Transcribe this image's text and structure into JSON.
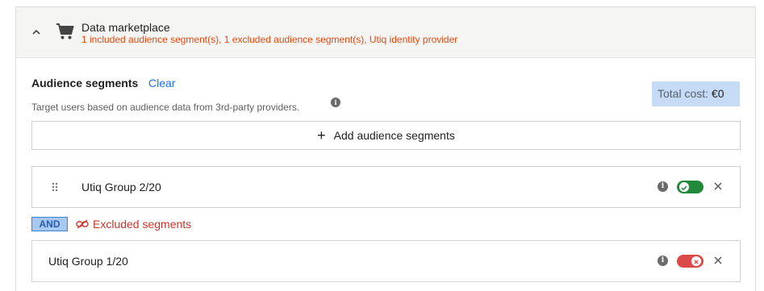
{
  "header": {
    "title": "Data marketplace",
    "summary": "1 included audience segment(s), 1 excluded audience segment(s), Utiq identity provider",
    "chevron_icon": "chevron-up-icon",
    "cart_icon": "shopping-cart-icon"
  },
  "audience": {
    "title": "Audience segments",
    "clear_label": "Clear",
    "description": "Target users based on audience data from 3rd-party providers.",
    "info_icon": "info-icon",
    "total_cost_label": "Total cost:",
    "total_cost_value": "€0",
    "add_button_label": "Add audience segments"
  },
  "segments": [
    {
      "name": "Utiq Group 2/20",
      "state": "included",
      "toggle_color": "#218a3a"
    },
    {
      "name": "Utiq Group 1/20",
      "state": "excluded",
      "toggle_color": "#dc4a4a"
    }
  ],
  "operator": {
    "label": "AND",
    "excluded_label": "Excluded segments",
    "excluded_color": "#d0352c"
  },
  "colors": {
    "accent_link": "#1a73e8",
    "summary_orange": "#e8470d",
    "total_cost_bg": "#c6dcf6"
  }
}
